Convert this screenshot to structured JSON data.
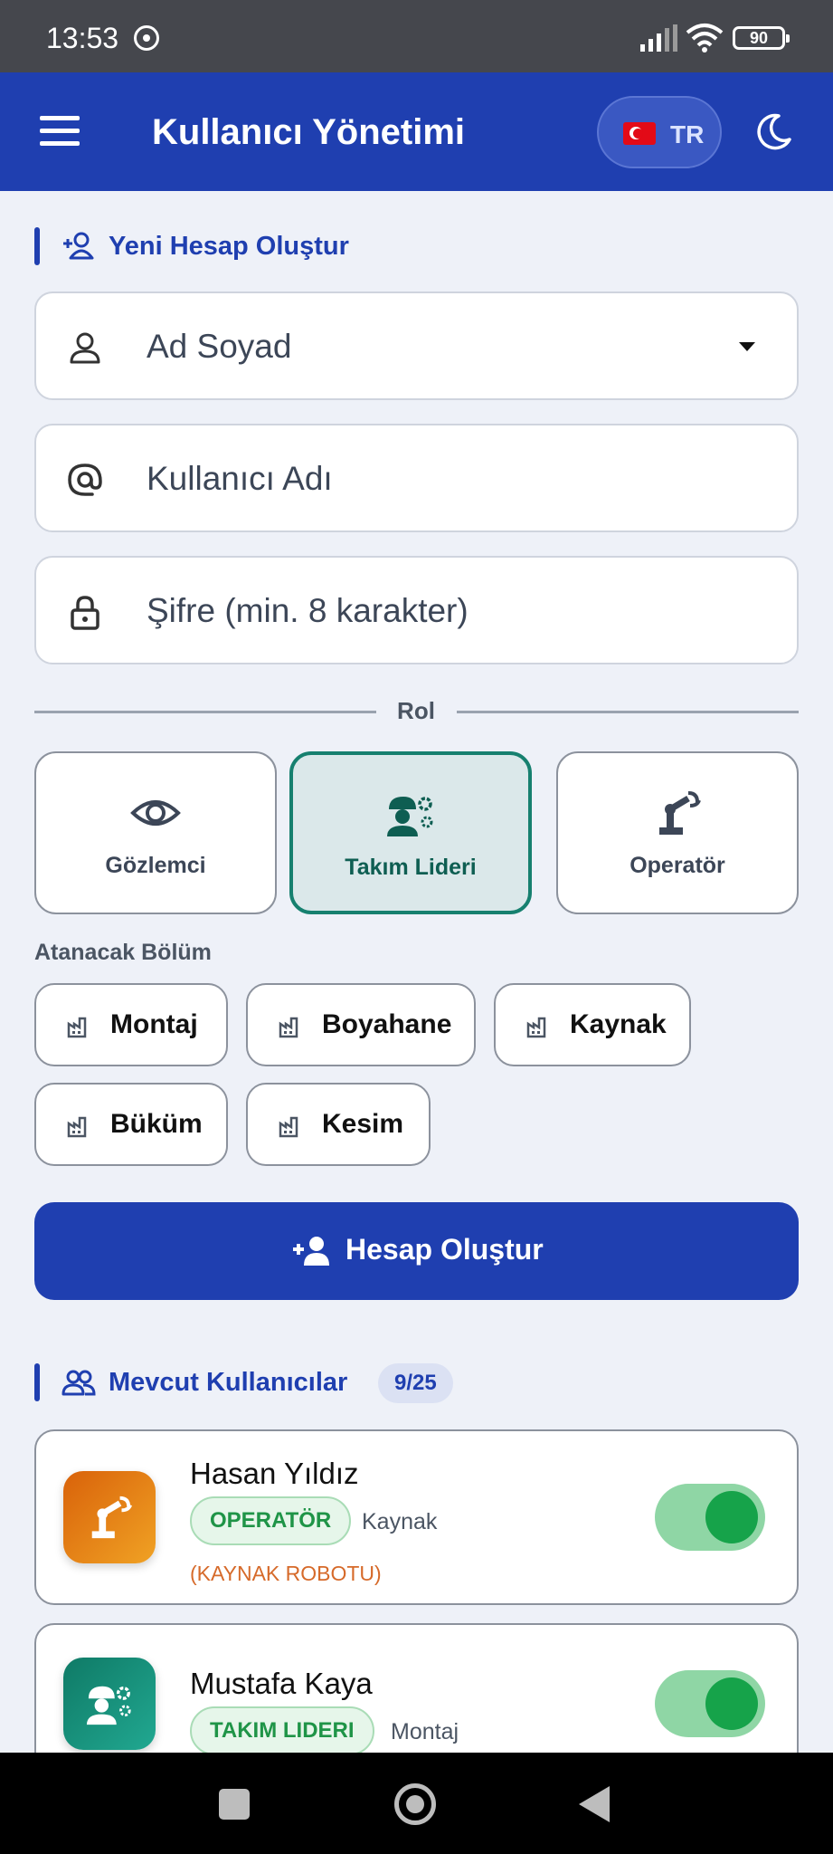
{
  "status_bar": {
    "time": "13:53",
    "battery": "90"
  },
  "app_bar": {
    "title": "Kullanıcı Yönetimi",
    "language_code": "TR"
  },
  "create_section": {
    "title": "Yeni Hesap Oluştur",
    "fields": {
      "full_name_placeholder": "Ad Soyad",
      "username_placeholder": "Kullanıcı Adı",
      "password_placeholder": "Şifre (min. 8 karakter)"
    },
    "role_label": "Rol",
    "roles": [
      {
        "label": "Gözlemci",
        "icon": "eye-icon",
        "selected": false
      },
      {
        "label": "Takım Lideri",
        "icon": "team-leader-icon",
        "selected": true
      },
      {
        "label": "Operatör",
        "icon": "robot-arm-icon",
        "selected": false
      }
    ],
    "department_label": "Atanacak Bölüm",
    "departments": [
      "Montaj",
      "Boyahane",
      "Kaynak",
      "Büküm",
      "Kesim"
    ],
    "submit_label": "Hesap Oluştur"
  },
  "users_section": {
    "title": "Mevcut Kullanıcılar",
    "count": "9/25",
    "users": [
      {
        "name": "Hasan Yıldız",
        "role": "OPERATÖR",
        "department": "Kaynak",
        "note": "(KAYNAK ROBOTU)",
        "active": true
      },
      {
        "name": "Mustafa Kaya",
        "role": "TAKIM LIDERI",
        "department": "Montaj",
        "active": true
      }
    ]
  },
  "colors": {
    "primary": "#1f3fb0",
    "selected_role": "#16806f",
    "toggle_on": "#16a34a",
    "note": "#d66a2a"
  }
}
